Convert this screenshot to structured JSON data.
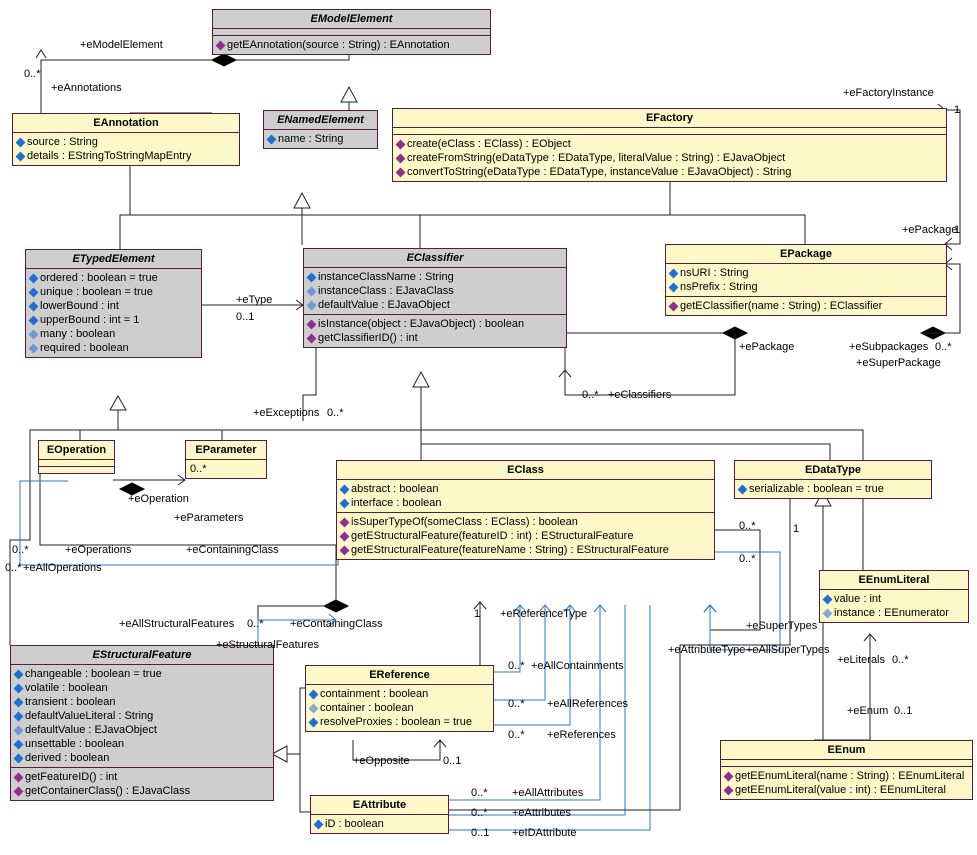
{
  "classes": {
    "EModelElement": {
      "name": "EModelElement",
      "operations": [
        "getEAnnotation(source : String) : EAnnotation"
      ]
    },
    "EAnnotation": {
      "name": "EAnnotation",
      "attributes": [
        "source : String",
        "details : EStringToStringMapEntry"
      ]
    },
    "ENamedElement": {
      "name": "ENamedElement",
      "attributes": [
        "name : String"
      ]
    },
    "EFactory": {
      "name": "EFactory",
      "operations": [
        "create(eClass : EClass) : EObject",
        "createFromString(eDataType : EDataType, literalValue : String) : EJavaObject",
        "convertToString(eDataType : EDataType, instanceValue : EJavaObject) : String"
      ]
    },
    "ETypedElement": {
      "name": "ETypedElement",
      "attributes": [
        "ordered : boolean = true",
        "unique : boolean = true",
        "lowerBound : int",
        "upperBound : int = 1"
      ],
      "derived": [
        "many : boolean",
        "required : boolean"
      ]
    },
    "EClassifier": {
      "name": "EClassifier",
      "attributes": [
        "instanceClassName : String"
      ],
      "derived": [
        "instanceClass : EJavaClass",
        "defaultValue : EJavaObject"
      ],
      "operations": [
        "isInstance(object : EJavaObject) : boolean",
        "getClassifierID() : int"
      ]
    },
    "EPackage": {
      "name": "EPackage",
      "attributes": [
        "nsURI : String",
        "nsPrefix : String"
      ],
      "operations": [
        "getEClassifier(name : String) : EClassifier"
      ]
    },
    "EOperation": {
      "name": "EOperation"
    },
    "EParameter": {
      "name": "EParameter",
      "mult": "0..*"
    },
    "EClass": {
      "name": "EClass",
      "attributes": [
        "abstract : boolean",
        "interface : boolean"
      ],
      "operations": [
        "isSuperTypeOf(someClass : EClass) : boolean",
        "getEStructuralFeature(featureID : int) : EStructuralFeature",
        "getEStructuralFeature(featureName : String) : EStructuralFeature"
      ]
    },
    "EDataType": {
      "name": "EDataType",
      "attributes": [
        "serializable : boolean = true"
      ]
    },
    "EEnumLiteral": {
      "name": "EEnumLiteral",
      "attributes": [
        "value : int"
      ],
      "derived": [
        "instance : EEnumerator"
      ]
    },
    "EStructuralFeature": {
      "name": "EStructuralFeature",
      "attributes": [
        "changeable : boolean = true",
        "volatile : boolean",
        "transient : boolean",
        "defaultValueLiteral : String"
      ],
      "derived": [
        "defaultValue : EJavaObject"
      ],
      "attributes2": [
        "unsettable : boolean",
        "derived : boolean"
      ],
      "operations": [
        "getFeatureID() : int",
        "getContainerClass() : EJavaClass"
      ]
    },
    "EReference": {
      "name": "EReference",
      "attributes": [
        "containment : boolean"
      ],
      "derived": [
        "container : boolean"
      ],
      "attributes2": [
        "resolveProxies : boolean = true"
      ]
    },
    "EAttribute": {
      "name": "EAttribute",
      "attributes": [
        "iD : boolean"
      ]
    },
    "EEnum": {
      "name": "EEnum",
      "operations": [
        "getEEnumLiteral(name : String) : EEnumLiteral",
        "getEEnumLiteral(value : int) : EEnumLiteral"
      ]
    }
  },
  "labels": {
    "eModelElement": "+eModelElement",
    "eAnnotations": "+eAnnotations",
    "m0s": "0..*",
    "eFactoryInstance": "+eFactoryInstance",
    "one": "1",
    "eType": "+eType",
    "m01": "0..1",
    "ePackage": "+ePackage",
    "ePackage2": "+ePackage",
    "eSubpackages": "+eSubpackages",
    "eSuperPackage": "+eSuperPackage",
    "eExceptions": "+eExceptions",
    "eClassifiers": "+eClassifiers",
    "eOperation": "+eOperation",
    "eParameters": "+eParameters",
    "eOperations": "+eOperations",
    "eAllOperations": "+eAllOperations",
    "eContainingClass": "+eContainingClass",
    "eContainingClass2": "+eContainingClass",
    "eAllStructuralFeatures": "+eAllStructuralFeatures",
    "eStructuralFeatures": "+eStructuralFeatures",
    "eReferenceType": "+eReferenceType",
    "eSuperTypes": "+eSuperTypes",
    "eAllSuperTypes": "+eAllSuperTypes",
    "eAllContainments": "+eAllContainments",
    "eAllReferences": "+eAllReferences",
    "eReferences": "+eReferences",
    "eOpposite": "+eOpposite",
    "eAllAttributes": "+eAllAttributes",
    "eAttributes": "+eAttributes",
    "eIDAttribute": "+eIDAttribute",
    "eAttributeType": "+eAttributeType",
    "eLiterals": "+eLiterals",
    "eEnum": "+eEnum"
  }
}
